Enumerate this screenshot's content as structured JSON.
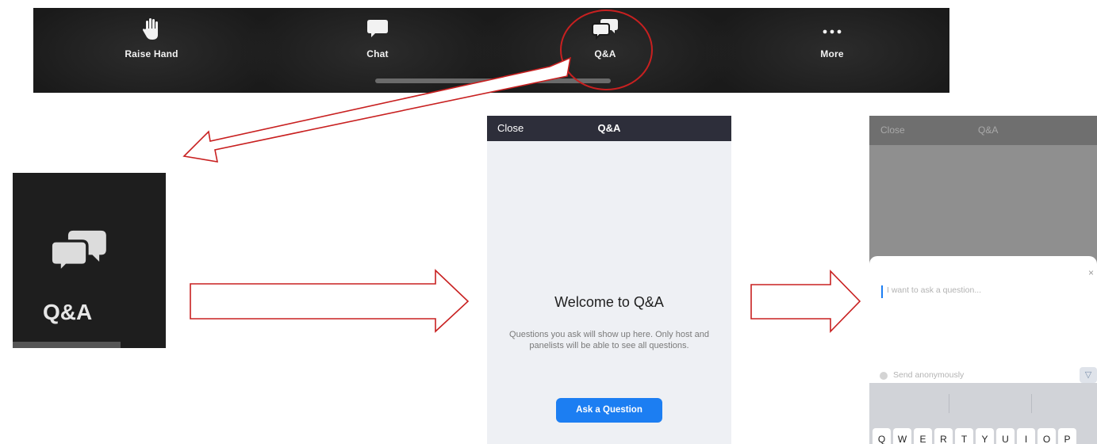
{
  "toolbar": {
    "items": [
      {
        "label": "Raise Hand",
        "icon": "raise-hand-icon"
      },
      {
        "label": "Chat",
        "icon": "chat-icon"
      },
      {
        "label": "Q&A",
        "icon": "qa-icon"
      },
      {
        "label": "More",
        "icon": "more-icon"
      }
    ],
    "highlight_color": "#c82020"
  },
  "zoomed_tile": {
    "label": "Q&A",
    "icon": "qa-icon"
  },
  "qa_screen": {
    "close_label": "Close",
    "title": "Q&A",
    "welcome_title": "Welcome to Q&A",
    "welcome_desc": "Questions you ask will show up here. Only host and panelists will be able to see all questions.",
    "ask_button": "Ask a Question",
    "accent": "#1c7ef2"
  },
  "compose_screen": {
    "close_label": "Close",
    "title": "Q&A",
    "input_placeholder": "I want to ask a question...",
    "close_glyph": "×",
    "send_anonymously": "Send anonymously",
    "keyboard_row": [
      "Q",
      "W",
      "E",
      "R",
      "T",
      "Y",
      "U",
      "I",
      "O",
      "P"
    ]
  }
}
